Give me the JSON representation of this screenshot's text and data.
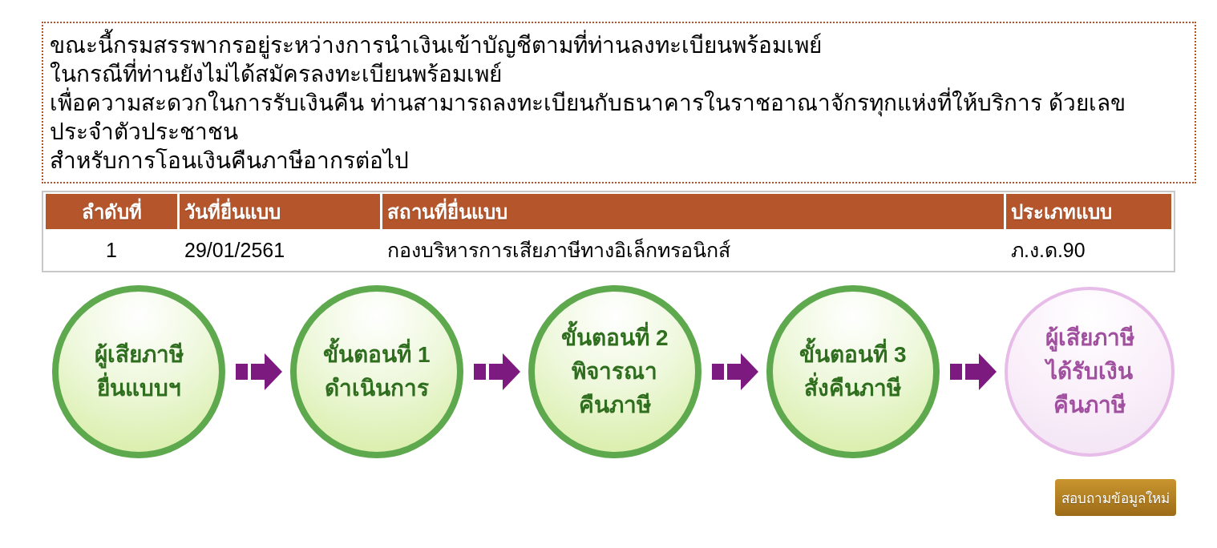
{
  "notice": {
    "lines": [
      "ขณะนี้กรมสรรพากรอยู่ระหว่างการนำเงินเข้าบัญชีตามที่ท่านลงทะเบียนพร้อมเพย์",
      "ในกรณีที่ท่านยังไม่ได้สมัครลงทะเบียนพร้อมเพย์",
      "เพื่อความสะดวกในการรับเงินคืน ท่านสามารถลงทะเบียนกับธนาคารในราชอาณาจักรทุกแห่งที่ให้บริการ ด้วยเลขประจำตัวประชาชน",
      "สำหรับการโอนเงินคืนภาษีอากรต่อไป"
    ]
  },
  "table": {
    "columns": [
      "ลำดับที่",
      "วันที่ยื่นแบบ",
      "สถานที่ยื่นแบบ",
      "ประเภทแบบ"
    ],
    "rows": [
      [
        "1",
        "29/01/2561",
        "กองบริหารการเสียภาษีทางอิเล็กทรอนิกส์",
        "ภ.ง.ด.90"
      ]
    ]
  },
  "steps": [
    {
      "lines": [
        "ผู้เสียภาษี",
        "ยื่นแบบฯ"
      ],
      "completed": true
    },
    {
      "lines": [
        "ขั้นตอนที่ 1",
        "ดำเนินการ"
      ],
      "completed": true
    },
    {
      "lines": [
        "ขั้นตอนที่ 2",
        "พิจารณา",
        "คืนภาษี"
      ],
      "completed": true
    },
    {
      "lines": [
        "ขั้นตอนที่ 3",
        "สั่งคืนภาษี"
      ],
      "completed": true
    },
    {
      "lines": [
        "ผู้เสียภาษี",
        "ได้รับเงิน",
        "คืนภาษี"
      ],
      "completed": false
    }
  ],
  "button": "สอบถามข้อมูลใหม่"
}
